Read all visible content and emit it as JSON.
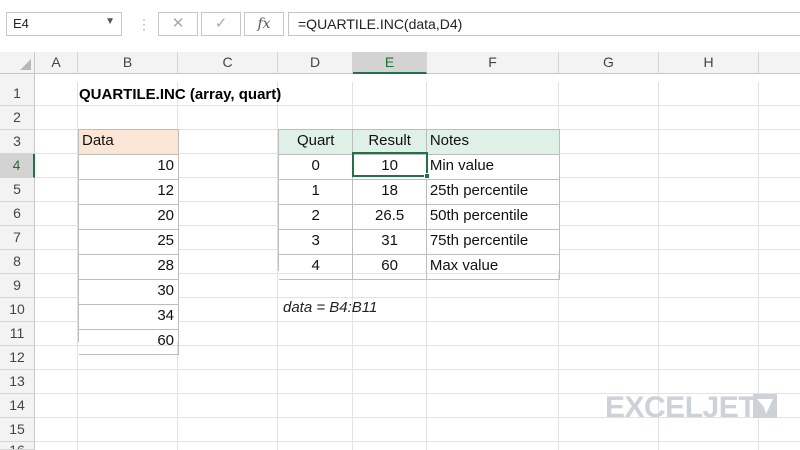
{
  "formula_bar": {
    "name_box": "E4",
    "cancel_glyph": "✕",
    "enter_glyph": "✓",
    "fx_label": "fx",
    "formula": "=QUARTILE.INC(data,D4)"
  },
  "columns": [
    "A",
    "B",
    "C",
    "D",
    "E",
    "F",
    "G",
    "H"
  ],
  "rows": [
    "1",
    "2",
    "3",
    "4",
    "5",
    "6",
    "7",
    "8",
    "9",
    "10",
    "11",
    "12",
    "13",
    "14",
    "15",
    "16"
  ],
  "selected_cell": {
    "col": "E",
    "row": "4"
  },
  "sheet": {
    "title": "QUARTILE.INC (array, quart)",
    "data_header": "Data",
    "data_values": [
      "10",
      "12",
      "20",
      "25",
      "28",
      "30",
      "34",
      "60"
    ],
    "table_headers": {
      "quart": "Quart",
      "result": "Result",
      "notes": "Notes"
    },
    "table_rows": [
      {
        "quart": "0",
        "result": "10",
        "notes": "Min value"
      },
      {
        "quart": "1",
        "result": "18",
        "notes": "25th percentile"
      },
      {
        "quart": "2",
        "result": "26.5",
        "notes": "50th percentile"
      },
      {
        "quart": "3",
        "result": "31",
        "notes": "75th percentile"
      },
      {
        "quart": "4",
        "result": "60",
        "notes": "Max value"
      }
    ],
    "named_range_note": "data = B4:B11"
  },
  "watermark": {
    "text": "EXCELJET",
    "icon": "exceljet-logo-icon",
    "color": "#cdd2d8"
  },
  "colors": {
    "accent": "#217346",
    "data_header_bg": "#fbe6d6",
    "table_header_bg": "#dff0e7"
  }
}
